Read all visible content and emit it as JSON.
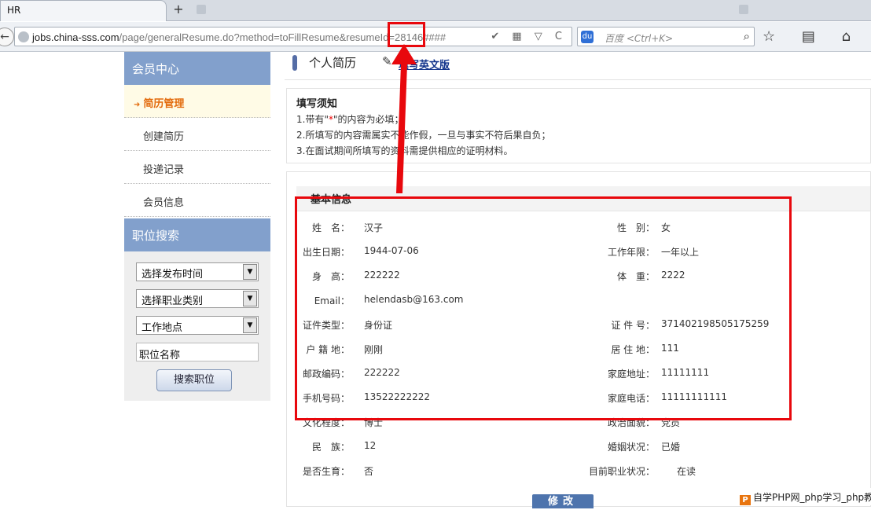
{
  "browser": {
    "tab_title": "HR",
    "new_tab": "+",
    "back": "←",
    "url_host": "jobs.china-sss.com",
    "url_prefix": "",
    "url_path": "/page/generalResume.do?method=toFillResume&resumeId=28146####",
    "url_icons": "✔ ▦ ▽ C",
    "search_placeholder": "百度 <Ctrl+K>",
    "search_logo": "du",
    "search_icon": "⌕",
    "toolbar_icons": "☆ ▤ ⌂ ↶"
  },
  "sidebar": {
    "member_center": "会员中心",
    "items": [
      {
        "label": "简历管理",
        "active": true
      },
      {
        "label": "创建简历"
      },
      {
        "label": "投递记录"
      },
      {
        "label": "会员信息"
      }
    ],
    "job_search_title": "职位搜索",
    "select_publish_time": "选择发布时间",
    "select_category": "选择职业类别",
    "select_location": "工作地点",
    "job_name_placeholder": "职位名称",
    "search_button": "搜索职位"
  },
  "main": {
    "title": "个人简历",
    "english_link": "填写英文版",
    "notice": {
      "title": "填写须知",
      "line1_prefix": "1.带有\"",
      "line1_star": "*",
      "line1_suffix": "\"的内容为必填；",
      "line2": "2.所填写的内容需属实不能作假，一旦与事实不符后果自负；",
      "line3": "3.在面试期间所填写的资料需提供相应的证明材料。"
    },
    "basic_info_title": "基本信息",
    "fields": [
      {
        "ll": "姓　名：",
        "lv": "汉子",
        "rl": "性　别：",
        "rv": "女"
      },
      {
        "ll": "出生日期：",
        "lv": "1944-07-06",
        "rl": "工作年限：",
        "rv": "一年以上"
      },
      {
        "ll": "身　高：",
        "lv": "222222",
        "rl": "体　重：",
        "rv": "2222"
      },
      {
        "ll": "Email：",
        "lv": "helendasb@163.com",
        "rl": "",
        "rv": ""
      },
      {
        "ll": "证件类型：",
        "lv": "身份证",
        "rl": "证 件 号：",
        "rv": "371402198505175259"
      },
      {
        "ll": "户 籍 地：",
        "lv": "刚刚",
        "rl": "居 住 地：",
        "rv": "111"
      },
      {
        "ll": "邮政编码：",
        "lv": "222222",
        "rl": "家庭地址：",
        "rv": "11111111"
      },
      {
        "ll": "手机号码：",
        "lv": "13522222222",
        "rl": "家庭电话：",
        "rv": "11111111111"
      },
      {
        "ll": "文化程度：",
        "lv": "博士",
        "rl": "政治面貌：",
        "rv": "党员"
      },
      {
        "ll": "民　族：",
        "lv": "12",
        "rl": "婚姻状况：",
        "rv": "已婚"
      },
      {
        "ll": "是否生育：",
        "lv": "否",
        "rl": "目前职业状况：",
        "rv": "在读"
      }
    ],
    "modify_button": "修改"
  },
  "watermark": {
    "logo": "P",
    "text": "自学PHP网_php学习_php教程"
  },
  "colors": {
    "sidebar_header": "#82a0cc",
    "active_item": "#e36b0d",
    "annotation_red": "#e8080d",
    "modify_button": "#4e74ad"
  }
}
